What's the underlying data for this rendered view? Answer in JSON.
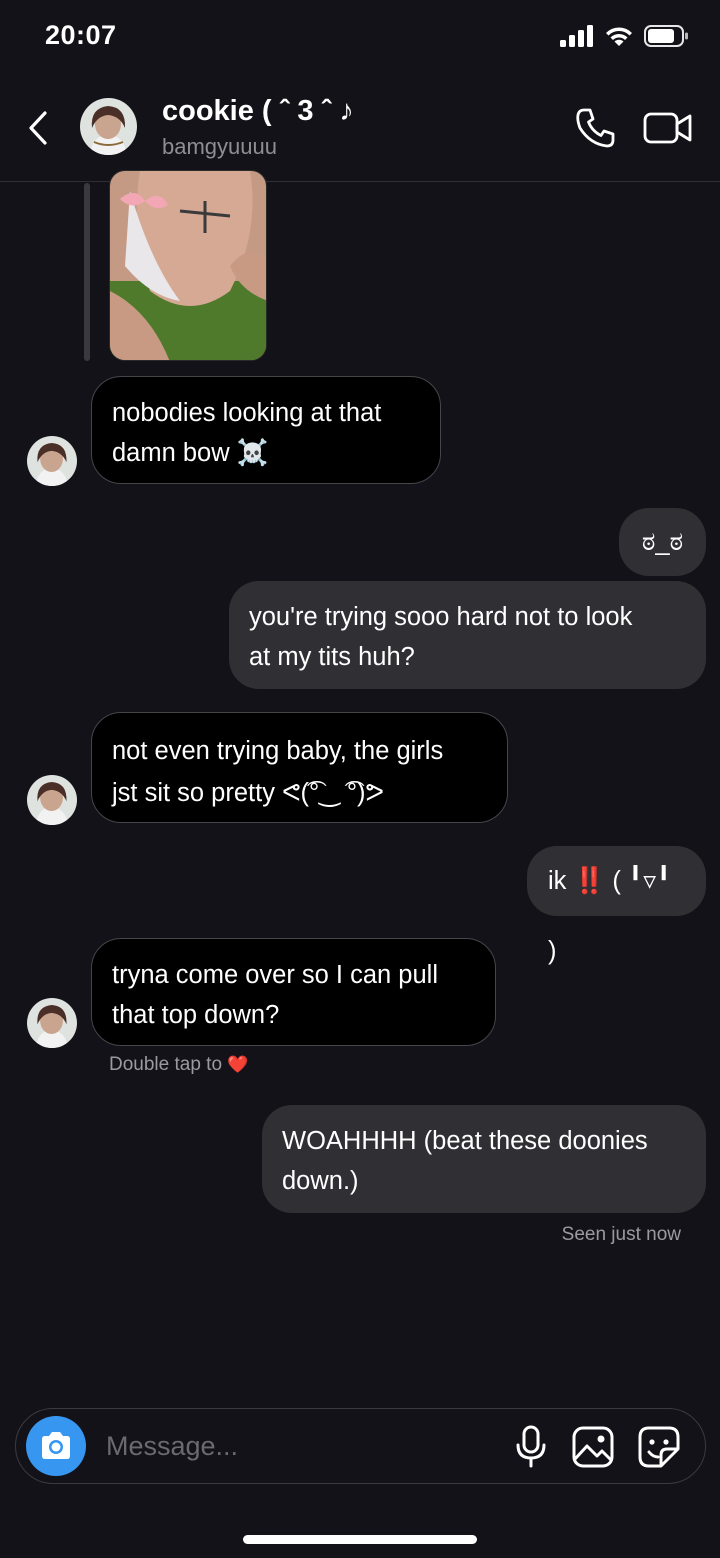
{
  "status_bar": {
    "time": "20:07",
    "icons": [
      "signal-icon",
      "wifi-icon",
      "battery-icon"
    ]
  },
  "header": {
    "name": "cookie ( ˆ 3 ˆ ♪",
    "username": "bamgyuuuu",
    "icons": [
      "chevron-left-icon",
      "phone-icon",
      "video-camera-icon"
    ]
  },
  "messages": [
    {
      "side": "in",
      "lines": [
        "nobodies looking at that",
        "damn bow ☠️"
      ]
    },
    {
      "side": "out",
      "lines": [
        "ಠ_ಠ"
      ]
    },
    {
      "side": "out",
      "lines": [
        "you're trying sooo hard not to look",
        "at my tits huh?"
      ]
    },
    {
      "side": "in",
      "lines": [
        "not even trying baby, the girls",
        "jst sit so pretty ᕙ(͡°‿ ͡°)ᕗ"
      ]
    },
    {
      "side": "out",
      "lines": [
        "ik ‼️ ( ╹▿╹ )"
      ]
    },
    {
      "side": "in",
      "lines": [
        "tryna come over so I can pull",
        "that top down?"
      ]
    },
    {
      "side": "out",
      "lines": [
        "WOAHHHH (beat these doonies",
        "down.)"
      ]
    }
  ],
  "reaction_hint": {
    "label": "Double tap to",
    "emoji": "❤️"
  },
  "seen_status": "Seen just now",
  "composer": {
    "placeholder": "Message...",
    "icons": [
      "camera-icon",
      "microphone-icon",
      "gallery-icon",
      "sticker-icon"
    ]
  },
  "colors": {
    "background": "#121218",
    "incoming_bubble": "#000000",
    "outgoing_bubble": "#303034",
    "accent": "#3797f0",
    "secondary_text": "#8e8e93"
  }
}
